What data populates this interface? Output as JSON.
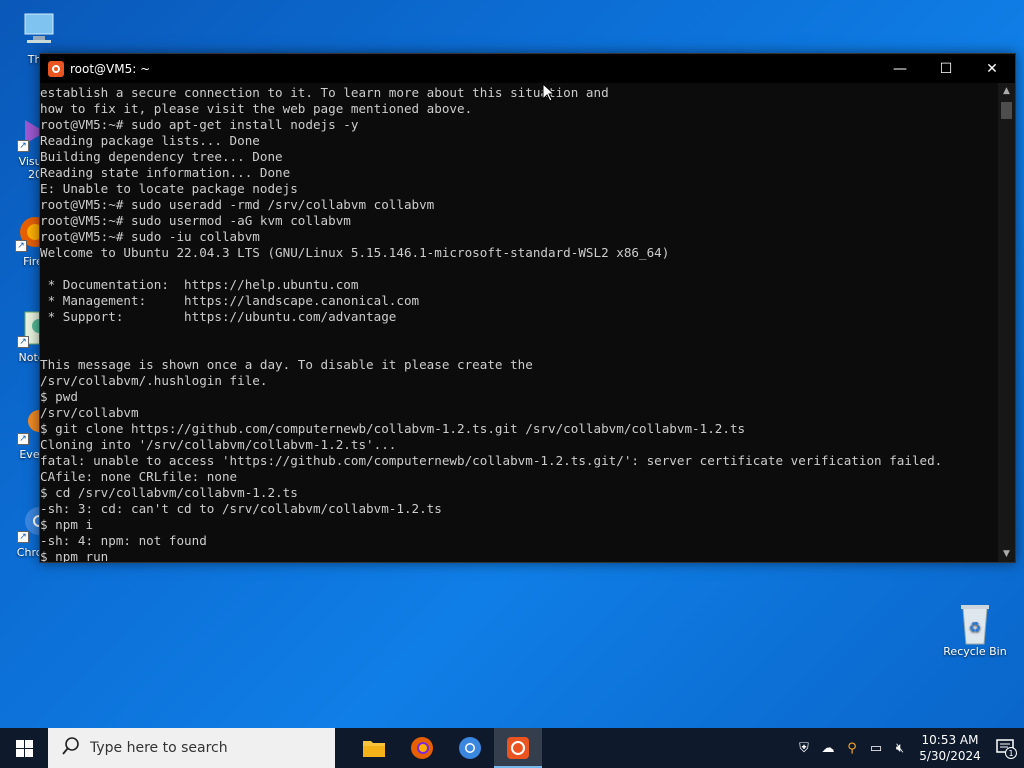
{
  "desktop": {
    "icons": [
      {
        "label": "This"
      },
      {
        "label": "Visual"
      },
      {
        "label": "20"
      },
      {
        "label": "Fire"
      },
      {
        "label": "Notep"
      },
      {
        "label": "Every"
      },
      {
        "label": "Chrom"
      },
      {
        "label": "Recycle Bin"
      }
    ]
  },
  "window": {
    "title": "root@VM5: ~",
    "controls": {
      "minimize": "—",
      "maximize": "☐",
      "close": "✕"
    }
  },
  "terminal": {
    "lines": [
      "establish a secure connection to it. To learn more about this situation and",
      "how to fix it, please visit the web page mentioned above.",
      "root@VM5:~# sudo apt-get install nodejs -y",
      "Reading package lists... Done",
      "Building dependency tree... Done",
      "Reading state information... Done",
      "E: Unable to locate package nodejs",
      "root@VM5:~# sudo useradd -rmd /srv/collabvm collabvm",
      "root@VM5:~# sudo usermod -aG kvm collabvm",
      "root@VM5:~# sudo -iu collabvm",
      "Welcome to Ubuntu 22.04.3 LTS (GNU/Linux 5.15.146.1-microsoft-standard-WSL2 x86_64)",
      "",
      " * Documentation:  https://help.ubuntu.com",
      " * Management:     https://landscape.canonical.com",
      " * Support:        https://ubuntu.com/advantage",
      "",
      "",
      "This message is shown once a day. To disable it please create the",
      "/srv/collabvm/.hushlogin file.",
      "$ pwd",
      "/srv/collabvm",
      "$ git clone https://github.com/computernewb/collabvm-1.2.ts.git /srv/collabvm/collabvm-1.2.ts",
      "Cloning into '/srv/collabvm/collabvm-1.2.ts'...",
      "fatal: unable to access 'https://github.com/computernewb/collabvm-1.2.ts.git/': server certificate verification failed.",
      "CAfile: none CRLfile: none",
      "$ cd /srv/collabvm/collabvm-1.2.ts",
      "-sh: 3: cd: can't cd to /srv/collabvm/collabvm-1.2.ts",
      "$ npm i",
      "-sh: 4: npm: not found",
      "$ npm run"
    ]
  },
  "taskbar": {
    "search_placeholder": "Type here to search",
    "clock_time": "10:53 AM",
    "clock_date": "5/30/2024",
    "notification_count": "1"
  },
  "colors": {
    "terminal_bg": "#0c0c0c",
    "terminal_fg": "#cccccc",
    "ubuntu_orange": "#e95420",
    "taskbar_bg": "#0e1a2b"
  }
}
